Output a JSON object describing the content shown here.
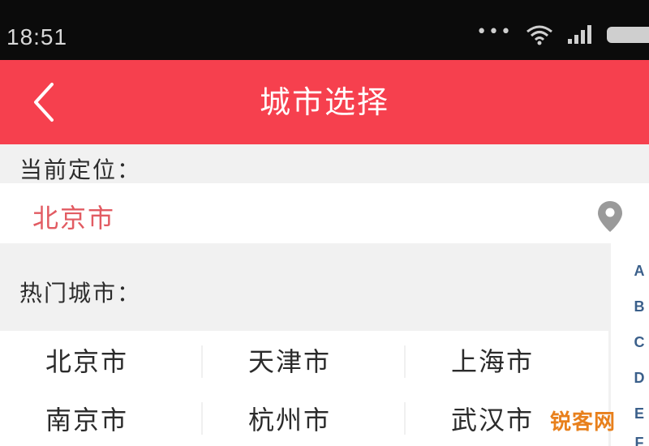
{
  "status_bar": {
    "time": "18:51",
    "dots": "•••"
  },
  "header": {
    "title": "城市选择"
  },
  "current_location": {
    "label": "当前定位：",
    "city": "北京市"
  },
  "hot_cities": {
    "label": "热门城市：",
    "rows": [
      [
        "北京市",
        "天津市",
        "上海市"
      ],
      [
        "南京市",
        "杭州市",
        "武汉市"
      ]
    ]
  },
  "index_letters": [
    "A",
    "B",
    "C",
    "D",
    "E",
    "F"
  ],
  "watermark": "锐客网",
  "colors": {
    "header_bg": "#f6404e",
    "current_city": "#e25b62",
    "index_letter": "#3a5f8a"
  }
}
